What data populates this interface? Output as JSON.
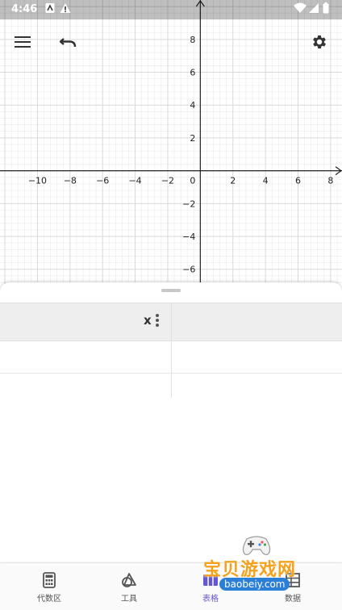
{
  "status_bar": {
    "time": "4:46"
  },
  "graph": {
    "x_ticks": [
      -10,
      -8,
      -6,
      -4,
      -2,
      2,
      4,
      6,
      8
    ],
    "y_ticks": [
      8,
      6,
      4,
      2,
      -2,
      -4,
      -6
    ],
    "origin_label": "0",
    "x_range": [
      -12.3,
      8.7
    ],
    "y_range": [
      -6.9,
      10.4
    ],
    "grid_color": "#d9d9d9",
    "minor_grid_color": "#ececec",
    "axis_color": "#222222"
  },
  "table": {
    "columns": [
      {
        "header": "x"
      },
      {
        "header": ""
      }
    ]
  },
  "bottom_nav": {
    "items": [
      {
        "label": "代数区"
      },
      {
        "label": "工具"
      },
      {
        "label": "表格"
      },
      {
        "label": "数据"
      }
    ]
  },
  "watermark": {
    "title": "宝贝游戏网",
    "url": "baobeiy.com"
  },
  "colors": {
    "accent": "#6557d2"
  }
}
